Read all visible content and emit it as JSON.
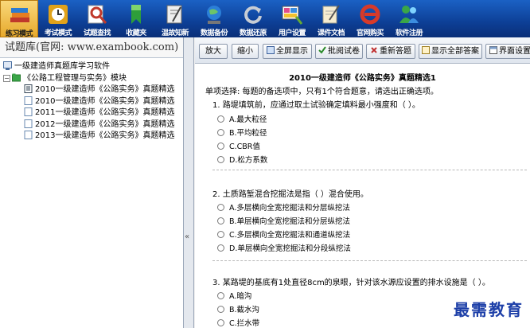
{
  "toolbar": {
    "items": [
      {
        "label": "练习模式",
        "icon": "books-icon",
        "color": "#c0392b"
      },
      {
        "label": "考试模式",
        "icon": "clock-icon",
        "color": "#e0a21a"
      },
      {
        "label": "试题查找",
        "icon": "magnifier-icon",
        "color": "#c0392b"
      },
      {
        "label": "收藏夹",
        "icon": "bookmark-icon",
        "color": "#2e9e3a"
      },
      {
        "label": "温故知新",
        "icon": "notebook-icon",
        "color": "#7a7a7a"
      },
      {
        "label": "数据备份",
        "icon": "globe-icon",
        "color": "#2b7fd8"
      },
      {
        "label": "数据还原",
        "icon": "refresh-icon",
        "color": "#9aa0a8"
      },
      {
        "label": "用户设置",
        "icon": "palette-icon",
        "color": "#e14b8a"
      },
      {
        "label": "课件文档",
        "icon": "document-pen-icon",
        "color": "#d8c48a"
      },
      {
        "label": "官网购买",
        "icon": "ie-icon",
        "color": "#d63a2a"
      },
      {
        "label": "软件注册",
        "icon": "users-icon",
        "color": "#3aa648"
      }
    ]
  },
  "left": {
    "header": "试题库(官网: www.exambook.com)",
    "tree": {
      "root": "一级建造师真题库学习软件",
      "module": "《公路工程管理与实务》模块",
      "items": [
        "2010一级建造师《公路实务》真题精选",
        "2010一级建造师《公路实务》真题精选",
        "2011一级建造师《公路实务》真题精选",
        "2012一级建造师《公路实务》真题精选",
        "2013一级建造师《公路实务》真题精选"
      ]
    },
    "splitter_glyph": "«"
  },
  "actions": {
    "zoom_in": "放大",
    "zoom_out": "缩小",
    "fullscreen": "全屏显示",
    "batch_grade": "批阅试卷",
    "redo": "重新答题",
    "show_all": "显示全部答案",
    "ui_settings": "界面设置"
  },
  "paper": {
    "title": "2010一级建造师《公路实务》真题精选1",
    "instructions": "单项选择: 每题的备选项中，只有1个符合题意，请选出正确选项。",
    "questions": [
      {
        "text": "1. 路堤填筑前，应通过取土试验确定填料最小强度和（   ）。",
        "options": [
          "A.最大粒径",
          "B.平均粒径",
          "C.CBR值",
          "D.松方系数"
        ]
      },
      {
        "text": "2. 土质路堑混合挖掘法是指（   ）混合使用。",
        "options": [
          "A.多层横向全宽挖掘法和分层纵挖法",
          "B.单层横向全宽挖掘法和分层纵挖法",
          "C.多层横向全宽挖掘法和通道纵挖法",
          "D.单层横向全宽挖掘法和分段纵挖法"
        ]
      },
      {
        "text": "3. 某路堤的基底有1处直径8cm的泉眼，针对该水源应设置的排水设施是（  ）。",
        "options": [
          "A.暗沟",
          "B.截水沟",
          "C.拦水带"
        ]
      }
    ]
  },
  "watermark": "最需教育"
}
